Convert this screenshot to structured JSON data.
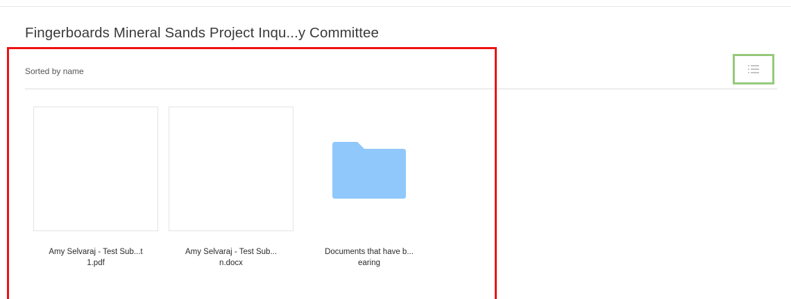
{
  "folder": {
    "title": "Fingerboards Mineral Sands Project Inqu...y Committee"
  },
  "toolbar": {
    "sort_label": "Sorted by name",
    "list_view_icon": "list-view-icon"
  },
  "items": [
    {
      "kind": "file",
      "name_line1": "Amy Selvaraj - Test Sub...t",
      "name_line2": "1.pdf"
    },
    {
      "kind": "file",
      "name_line1": "Amy Selvaraj - Test Sub...",
      "name_line2": "n.docx"
    },
    {
      "kind": "folder",
      "name_line1": "Documents that have b...",
      "name_line2": "earing",
      "icon": "folder-icon",
      "icon_color": "#90c8fb"
    }
  ],
  "colors": {
    "highlight_red": "#ee1111",
    "highlight_green": "#95c97a",
    "folder_blue": "#90c8fb"
  }
}
